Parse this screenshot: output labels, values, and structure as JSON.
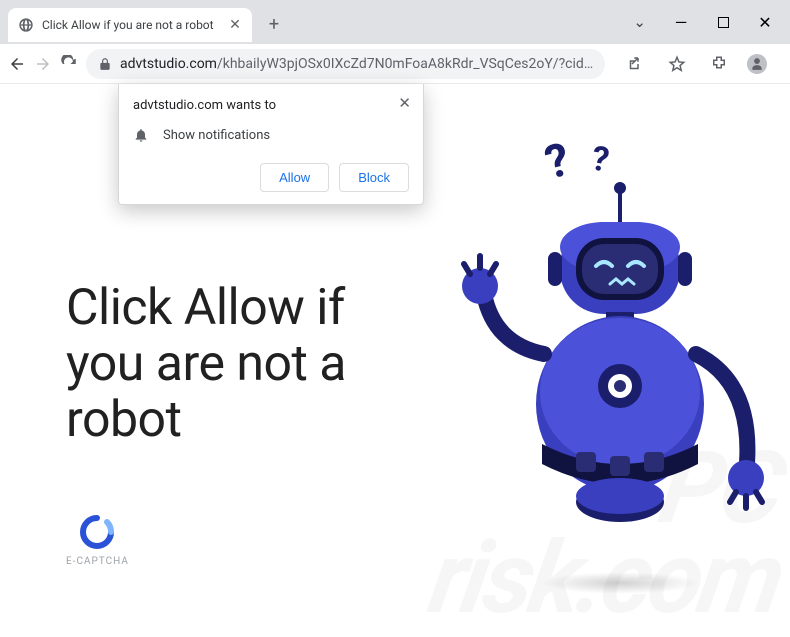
{
  "window": {
    "tab_title": "Click Allow if you are not a robot"
  },
  "url": {
    "domain": "advtstudio.com",
    "path": "/khbailyW3pjOSx0IXcZd7N0mFoaA8kRdr_VSqCes2oY/?cid…"
  },
  "permission": {
    "origin_text": "advtstudio.com wants to",
    "perm_text": "Show notifications",
    "allow_label": "Allow",
    "block_label": "Block"
  },
  "page": {
    "headline_l1": "Click Allow if",
    "headline_l2": "you are not a",
    "headline_l3": "robot",
    "captcha_label": "E-CAPTCHA"
  },
  "icons": {
    "back": "←",
    "forward": "→",
    "reload": "⟳",
    "share": "↗",
    "star": "☆",
    "ext": "▣",
    "menu": "⋮",
    "chev": "⌄",
    "min": "—",
    "max": "▢",
    "close": "✕",
    "plus": "+",
    "tabx": "✕",
    "q1": "?",
    "q2": "?"
  },
  "colors": {
    "accent": "#1a73e8",
    "robot_body": "#3a3fbf",
    "robot_dark": "#1b1e6b",
    "robot_visor": "#2a2d74"
  }
}
